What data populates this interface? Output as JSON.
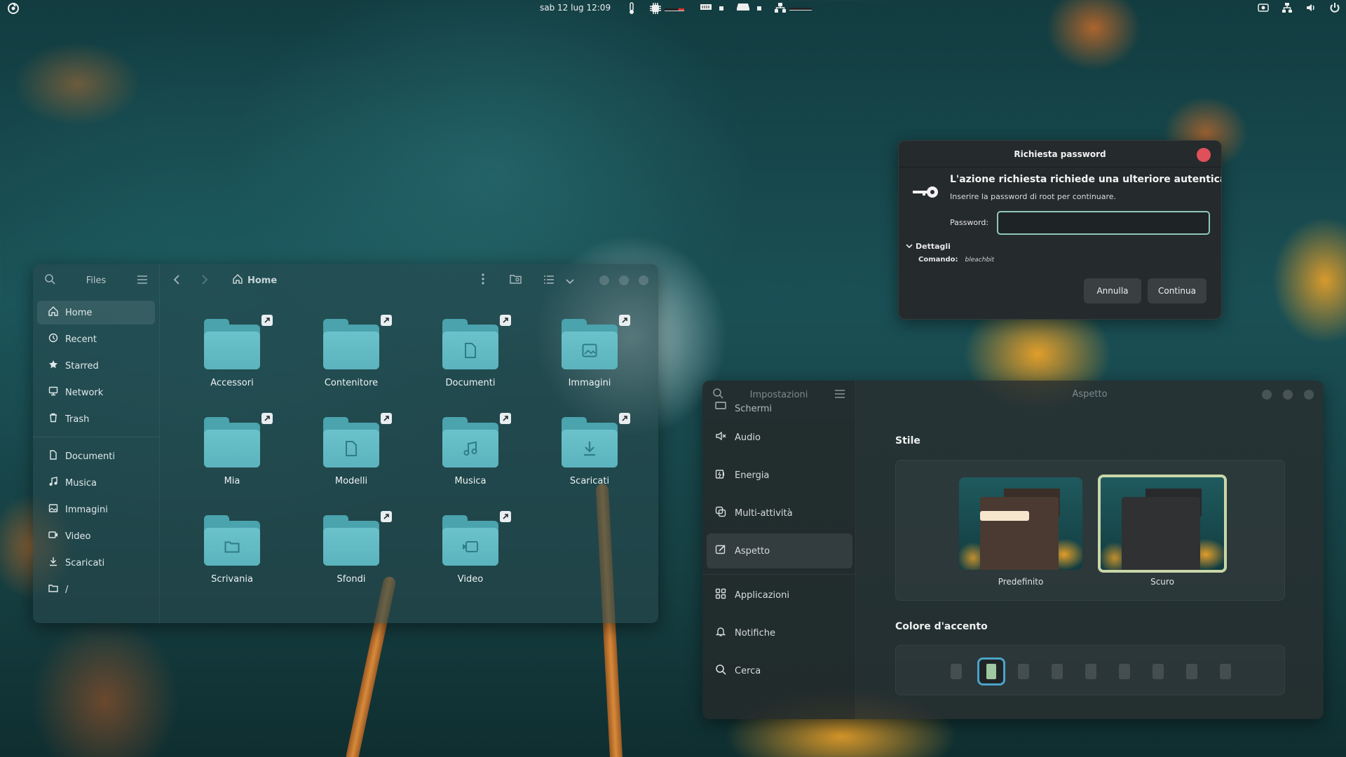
{
  "topbar": {
    "clock": "sab 12 lug  12:09"
  },
  "files": {
    "sidebar_title": "Files",
    "breadcrumb": "Home",
    "places": [
      {
        "label": "Home",
        "icon": "home-icon"
      },
      {
        "label": "Recent",
        "icon": "clock-icon"
      },
      {
        "label": "Starred",
        "icon": "star-icon"
      },
      {
        "label": "Network",
        "icon": "network-icon"
      },
      {
        "label": "Trash",
        "icon": "trash-icon"
      }
    ],
    "bookmarks": [
      {
        "label": "Documenti",
        "icon": "document-icon"
      },
      {
        "label": "Musica",
        "icon": "music-icon"
      },
      {
        "label": "Immagini",
        "icon": "image-icon"
      },
      {
        "label": "Video",
        "icon": "video-icon"
      },
      {
        "label": "Scaricati",
        "icon": "download-icon"
      },
      {
        "label": "/",
        "icon": "folder-icon"
      }
    ],
    "folders": [
      {
        "label": "Accessori",
        "emblem": "",
        "link": true
      },
      {
        "label": "Contenitore",
        "emblem": "",
        "link": true
      },
      {
        "label": "Documenti",
        "emblem": "document",
        "link": true
      },
      {
        "label": "Immagini",
        "emblem": "image",
        "link": true
      },
      {
        "label": "Mia",
        "emblem": "",
        "link": true
      },
      {
        "label": "Modelli",
        "emblem": "document",
        "link": true
      },
      {
        "label": "Musica",
        "emblem": "music",
        "link": true
      },
      {
        "label": "Scaricati",
        "emblem": "download",
        "link": true
      },
      {
        "label": "Scrivania",
        "emblem": "folder",
        "link": false
      },
      {
        "label": "Sfondi",
        "emblem": "",
        "link": true
      },
      {
        "label": "Video",
        "emblem": "video",
        "link": true
      }
    ]
  },
  "dialog": {
    "title": "Richiesta password",
    "heading": "L'azione richiesta richiede una ulteriore autenticazione",
    "subtitle": "Inserire la password di root per continuare.",
    "password_label": "Password:",
    "password_value": "",
    "details_label": "Dettagli",
    "command_label": "Comando:",
    "command_value": "bleachbit",
    "cancel_label": "Annulla",
    "continue_label": "Continua"
  },
  "settings": {
    "sidebar_title": "Impostazioni",
    "main_title": "Aspetto",
    "partial_item": "Schermi",
    "items": [
      {
        "label": "Audio",
        "icon": "speaker-icon"
      },
      {
        "label": "Energia",
        "icon": "battery-icon"
      },
      {
        "label": "Multi-attività",
        "icon": "multitasking-icon"
      },
      {
        "label": "Aspetto",
        "icon": "appearance-icon",
        "active": true
      },
      {
        "label": "Applicazioni",
        "icon": "apps-icon"
      },
      {
        "label": "Notifiche",
        "icon": "bell-icon"
      },
      {
        "label": "Cerca",
        "icon": "search-icon"
      }
    ],
    "style_heading": "Stile",
    "style_options": [
      {
        "label": "Predefinito",
        "selected": false
      },
      {
        "label": "Scuro",
        "selected": true
      }
    ],
    "accent_heading": "Colore d'accento",
    "accent_selected_index": 1,
    "accent_count": 9,
    "colors": {
      "selected_style_border": "#c9d6a8",
      "accent_selected_fill": "#9fc7a0",
      "accent_selected_ring": "#4aa3c8"
    }
  }
}
